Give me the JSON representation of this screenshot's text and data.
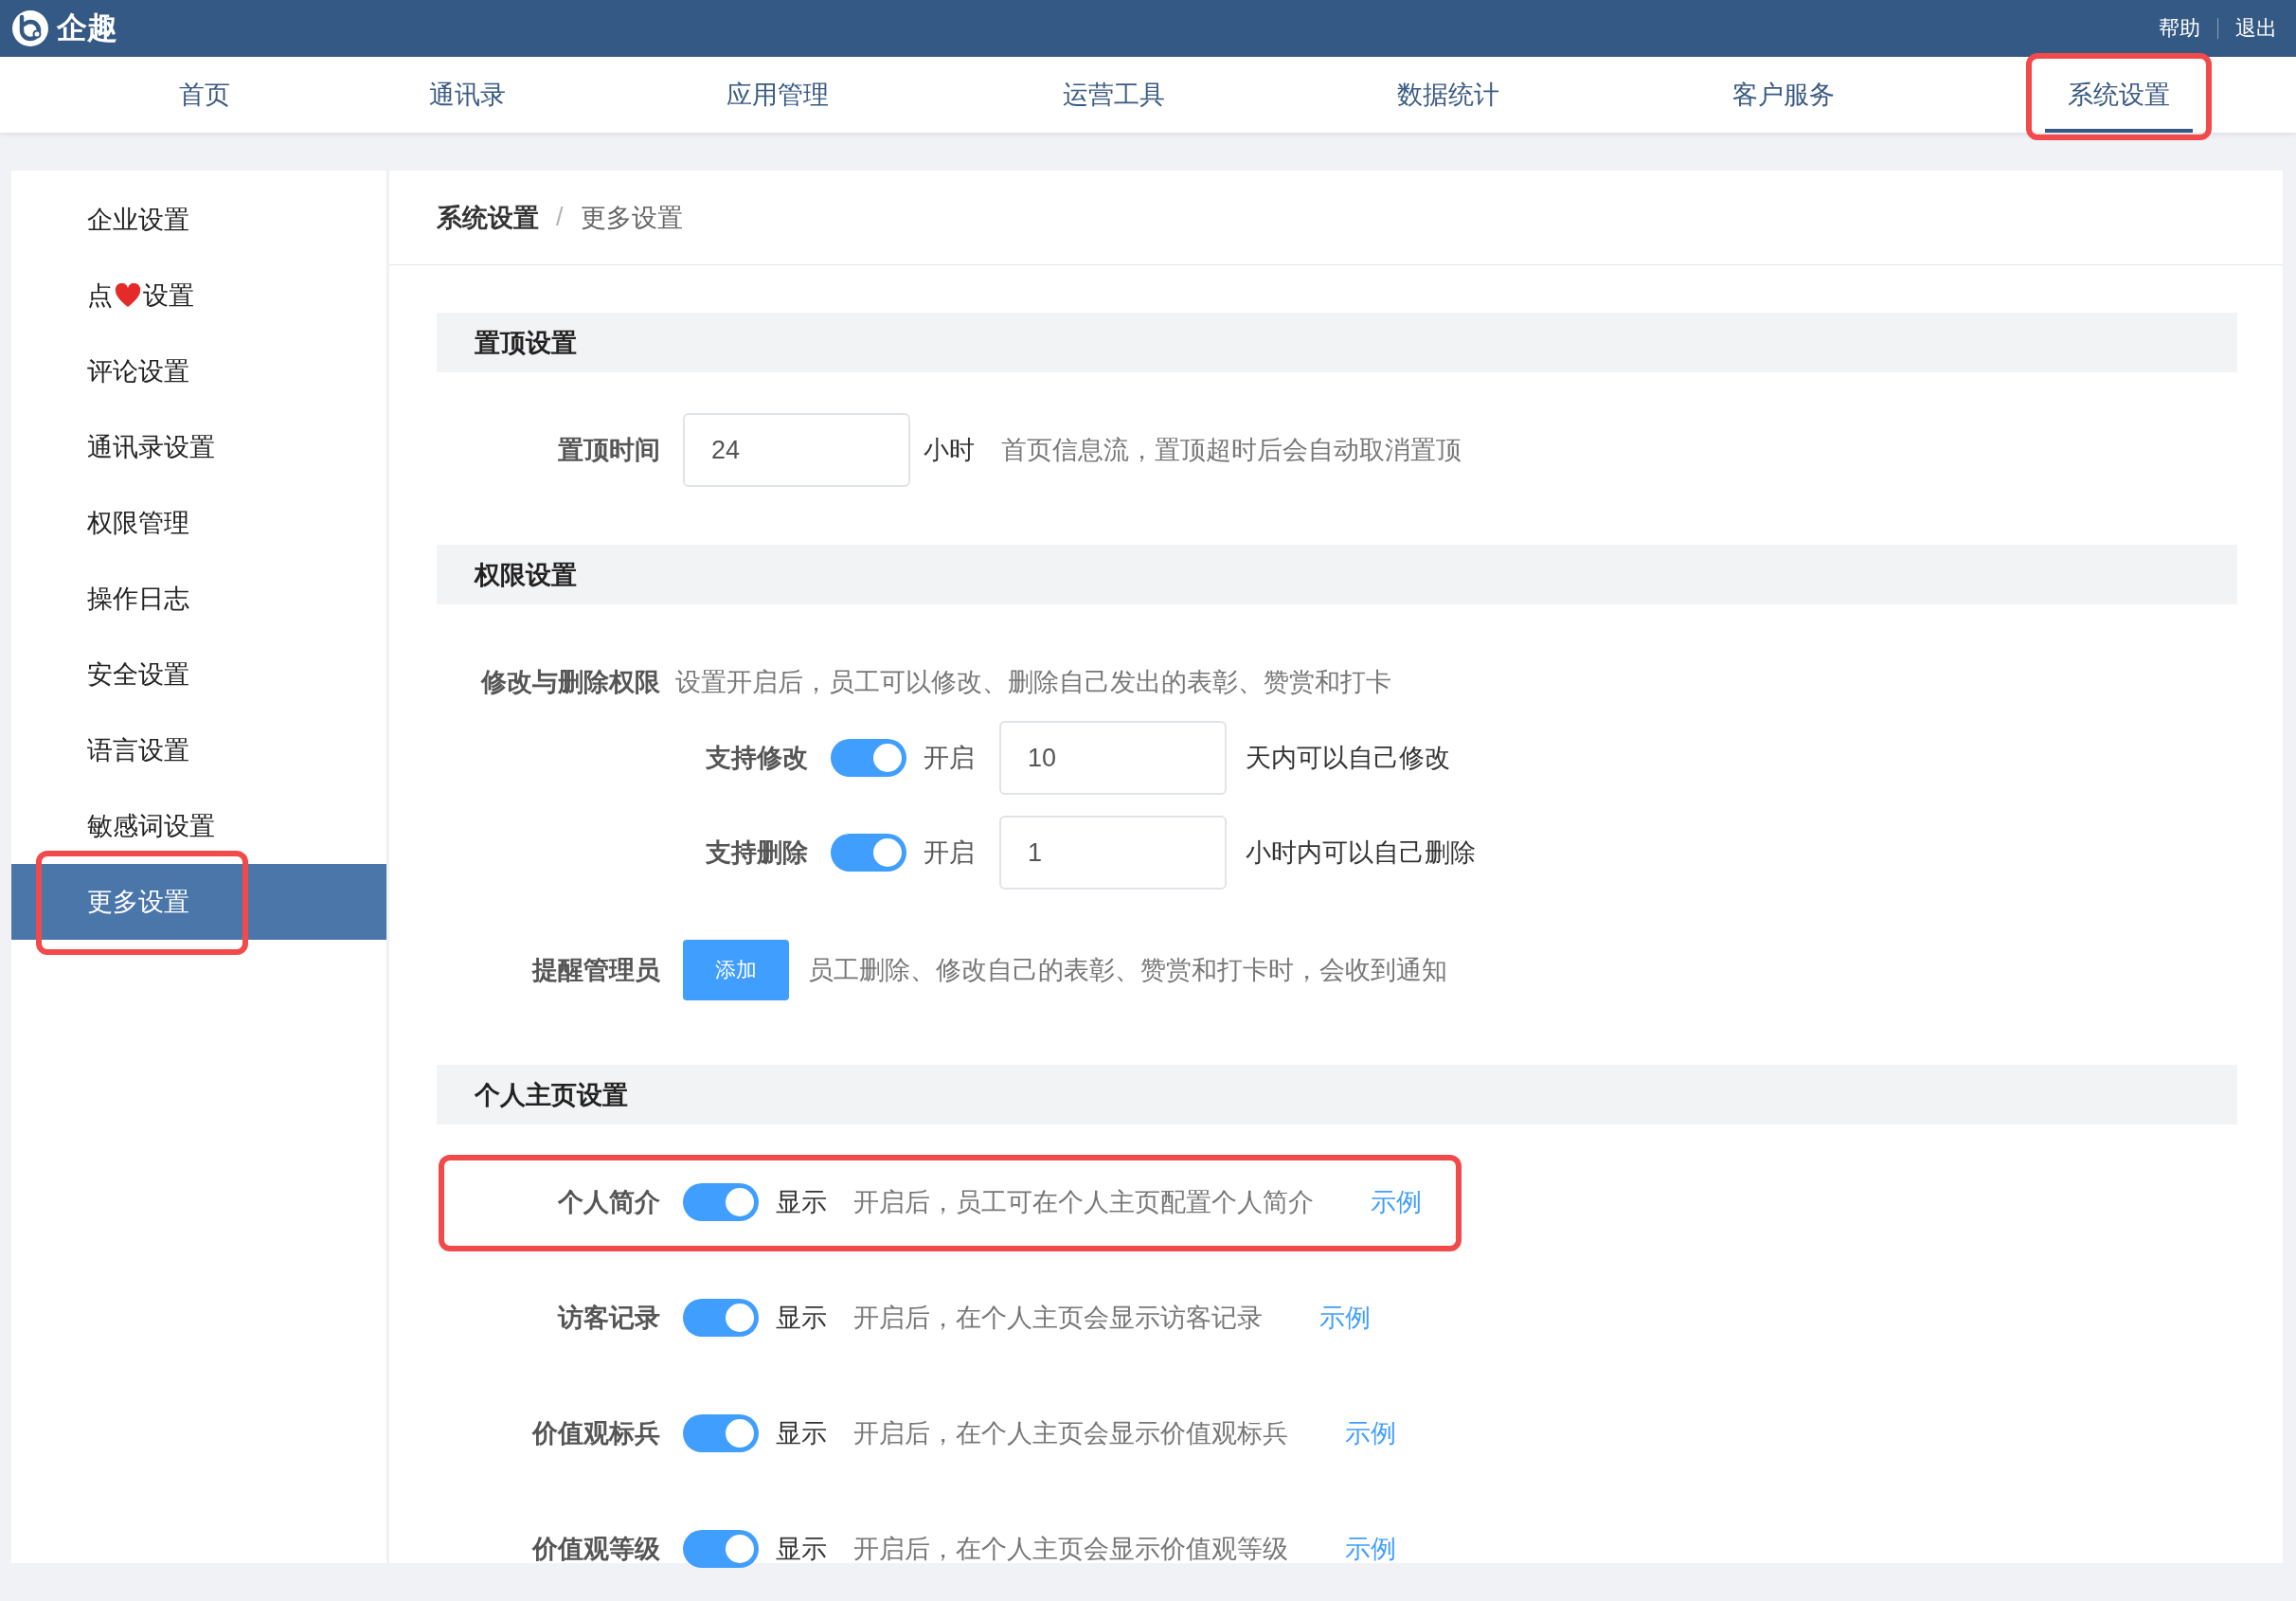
{
  "header": {
    "logo": "企趣",
    "links": [
      "帮助",
      "退出"
    ]
  },
  "nav": [
    {
      "label": "首页",
      "selected": false,
      "highlighted": false
    },
    {
      "label": "通讯录",
      "selected": false,
      "highlighted": false
    },
    {
      "label": "应用管理",
      "selected": false,
      "highlighted": false
    },
    {
      "label": "运营工具",
      "selected": false,
      "highlighted": false
    },
    {
      "label": "数据统计",
      "selected": false,
      "highlighted": false
    },
    {
      "label": "客户服务",
      "selected": false,
      "highlighted": false
    },
    {
      "label": "系统设置",
      "selected": true,
      "highlighted": true
    }
  ],
  "sidebar": {
    "items": [
      {
        "kind": "plain",
        "label": "企业设置",
        "selected": false,
        "highlighted": false
      },
      {
        "kind": "heart",
        "label": "点",
        "label_after": "设置",
        "selected": false,
        "highlighted": false
      },
      {
        "kind": "plain",
        "label": "评论设置",
        "selected": false,
        "highlighted": false
      },
      {
        "kind": "plain",
        "label": "通讯录设置",
        "selected": false,
        "highlighted": false
      },
      {
        "kind": "plain",
        "label": "权限管理",
        "selected": false,
        "highlighted": false
      },
      {
        "kind": "plain",
        "label": "操作日志",
        "selected": false,
        "highlighted": false
      },
      {
        "kind": "plain",
        "label": "安全设置",
        "selected": false,
        "highlighted": false
      },
      {
        "kind": "plain",
        "label": "语言设置",
        "selected": false,
        "highlighted": false
      },
      {
        "kind": "plain",
        "label": "敏感词设置",
        "selected": false,
        "highlighted": false
      },
      {
        "kind": "plain",
        "label": "更多设置",
        "selected": true,
        "highlighted": true
      }
    ]
  },
  "breadcrumb": {
    "items": [
      "系统设置",
      "更多设置"
    ],
    "separator": "/"
  },
  "sections": [
    {
      "title": "置顶设置",
      "rows": [
        {
          "kind": "input",
          "label": "置顶时间",
          "value": "24",
          "unit": "小时",
          "hint": "首页信息流，置顶超时后会自动取消置顶"
        }
      ]
    },
    {
      "title": "权限设置",
      "rows": [
        {
          "kind": "text",
          "label": "修改与删除权限",
          "hint": "设置开启后，员工可以修改、删除自己发出的表彰、赞赏和打卡"
        },
        {
          "kind": "toggle_input",
          "label": "支持修改",
          "on": true,
          "state_text": "开启",
          "value": "10",
          "unit": "天内可以自己修改"
        },
        {
          "kind": "toggle_input",
          "label": "支持删除",
          "on": true,
          "state_text": "开启",
          "value": "1",
          "unit": "小时内可以自己删除"
        },
        {
          "kind": "button",
          "label": "提醒管理员",
          "button": "添加",
          "hint": "员工删除、修改自己的表彰、赞赏和打卡时，会收到通知"
        }
      ]
    },
    {
      "title": "个人主页设置",
      "rows": [
        {
          "kind": "toggle",
          "label": "个人简介",
          "on": true,
          "state_text": "显示",
          "hint": "开启后，员工可在个人主页配置个人简介",
          "link": "示例",
          "highlighted": true
        },
        {
          "kind": "toggle",
          "label": "访客记录",
          "on": true,
          "state_text": "显示",
          "hint": "开启后，在个人主页会显示访客记录",
          "link": "示例",
          "highlighted": false
        },
        {
          "kind": "toggle",
          "label": "价值观标兵",
          "on": true,
          "state_text": "显示",
          "hint": "开启后，在个人主页会显示价值观标兵",
          "link": "示例",
          "highlighted": false
        },
        {
          "kind": "toggle",
          "label": "价值观等级",
          "on": true,
          "state_text": "显示",
          "hint": "开启后，在个人主页会显示价值观等级",
          "link": "示例",
          "highlighted": false
        }
      ]
    }
  ]
}
